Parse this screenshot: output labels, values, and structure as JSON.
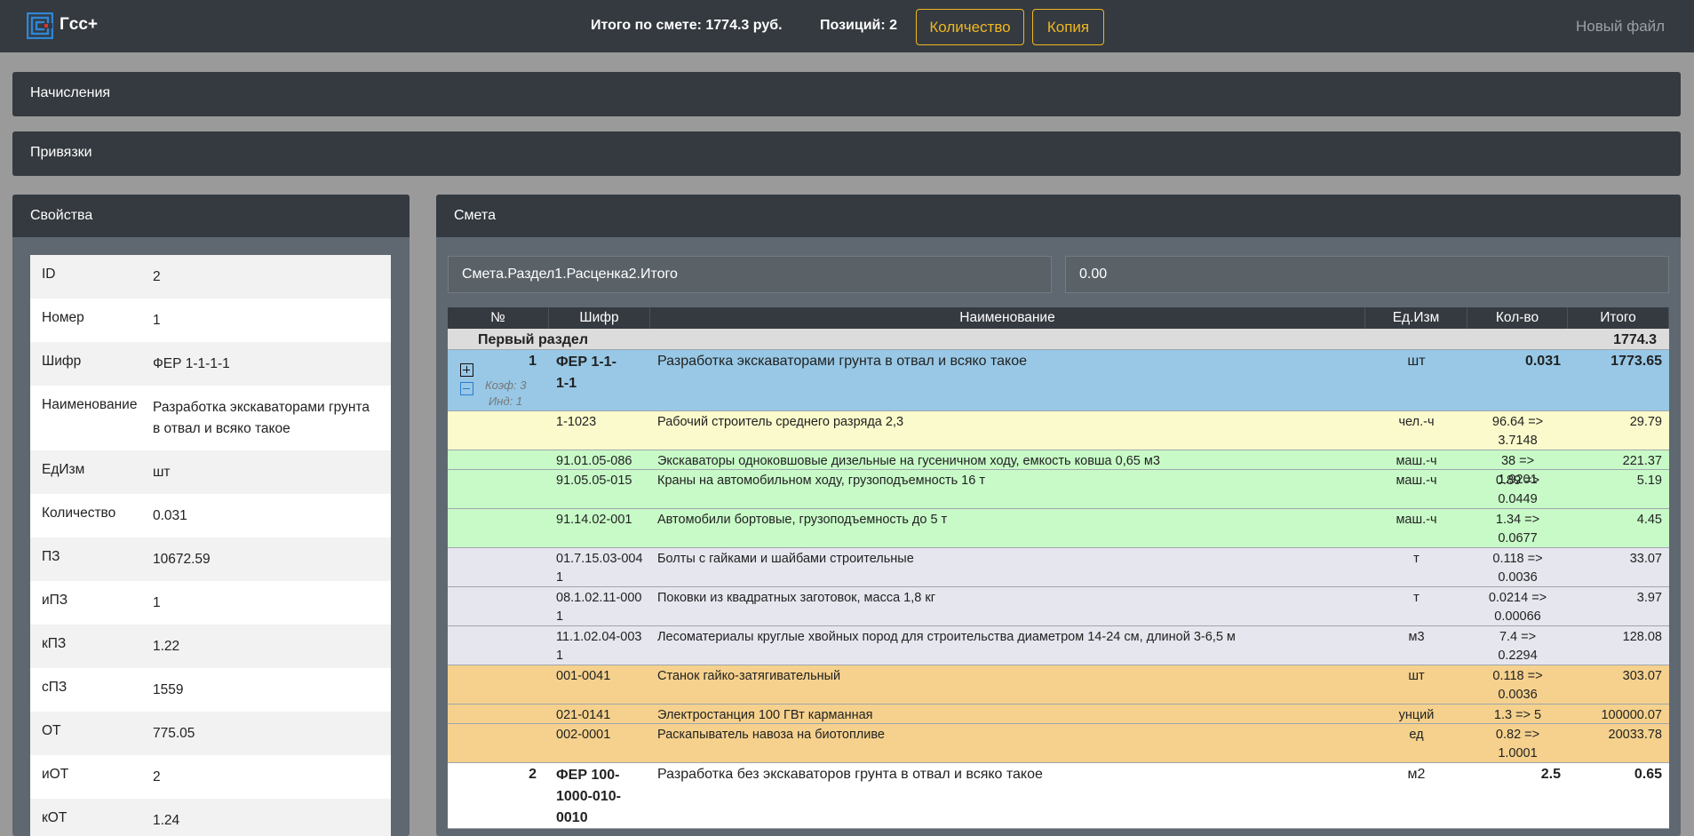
{
  "app": {
    "name": "Гсс+",
    "total_label": "Итого по смете: 1774.3 руб.",
    "positions_label": "Позиций: 2",
    "btn_quantity": "Количество",
    "btn_copy": "Копия",
    "new_file": "Новый файл",
    "accent": "#f0b722"
  },
  "cards": {
    "accruals": "Начисления",
    "links": "Привязки"
  },
  "properties": {
    "title": "Свойства",
    "rows": [
      {
        "key": "ID",
        "value": "2"
      },
      {
        "key": "Номер",
        "value": "1"
      },
      {
        "key": "Шифр",
        "value": "ФЕР 1-1-1-1"
      },
      {
        "key": "Наименование",
        "value": "Разработка экскаваторами грунта в отвал и всяко такое"
      },
      {
        "key": "ЕдИзм",
        "value": "шт"
      },
      {
        "key": "Количество",
        "value": "0.031"
      },
      {
        "key": "ПЗ",
        "value": "10672.59"
      },
      {
        "key": "иПЗ",
        "value": "1"
      },
      {
        "key": "кПЗ",
        "value": "1.22"
      },
      {
        "key": "сПЗ",
        "value": "1559"
      },
      {
        "key": "ОТ",
        "value": "775.05"
      },
      {
        "key": "иОТ",
        "value": "2"
      },
      {
        "key": "кОТ",
        "value": "1.24"
      }
    ]
  },
  "smeta": {
    "title": "Смета",
    "path_value": "Смета.Раздел1.Расценка2.Итого",
    "field_value": "0.00",
    "columns": [
      "№",
      "Шифр",
      "Наименование",
      "Ед.Изм",
      "Кол-во",
      "Итого"
    ],
    "section": {
      "name": "Первый раздел",
      "total": "1774.3"
    },
    "item1": {
      "no": "1",
      "code": "ФЕР 1-1-1-1",
      "name": "Разработка экскаваторами грунта в отвал и всяко такое",
      "unit": "шт",
      "qty": "0.031",
      "total": "1773.65",
      "coef": "Коэф: 3",
      "ind": "Инд: 1"
    },
    "resources": [
      {
        "type": "labor",
        "code": "1-1023",
        "name": "Рабочий строитель среднего разряда 2,3",
        "unit": "чел.-ч",
        "qty": "96.64 => 3.7148",
        "total": "29.79"
      },
      {
        "type": "mach",
        "code": "91.01.05-086",
        "name": "Экскаваторы одноковшовые дизельные на гусеничном ходу, емкость ковша 0,65 м3",
        "unit": "маш.-ч",
        "qty": "38 => 1.9201",
        "total": "221.37"
      },
      {
        "type": "mach",
        "code": "91.05.05-015",
        "name": "Краны на автомобильном ходу, грузоподъемность 16 т",
        "unit": "маш.-ч",
        "qty": "0.89 => 0.0449",
        "total": "5.19"
      },
      {
        "type": "mach",
        "code": "91.14.02-001",
        "name": "Автомобили бортовые, грузоподъемность до 5 т",
        "unit": "маш.-ч",
        "qty": "1.34 => 0.0677",
        "total": "4.45"
      },
      {
        "type": "mat",
        "code": "01.7.15.03-0041",
        "name": "Болты с гайками и шайбами строительные",
        "unit": "т",
        "qty": "0.118 => 0.0036",
        "total": "33.07"
      },
      {
        "type": "mat",
        "code": "08.1.02.11-0001",
        "name": "Поковки из квадратных заготовок, масса 1,8 кг",
        "unit": "т",
        "qty": "0.0214 => 0.00066",
        "total": "3.97"
      },
      {
        "type": "mat",
        "code": "11.1.02.04-0031",
        "name": "Лесоматериалы круглые хвойных пород для строительства диаметром 14-24 см, длиной 3-6,5 м",
        "unit": "м3",
        "qty": "7.4 => 0.2294",
        "total": "128.08"
      },
      {
        "type": "equip",
        "code": "001-0041",
        "name": "Станок гайко-затягивательный",
        "unit": "шт",
        "qty": "0.118 => 0.0036",
        "total": "303.07"
      },
      {
        "type": "equip",
        "code": "021-0141",
        "name": "Электростанция 100 ГВт карманная",
        "unit": "унций",
        "qty": "1.3 => 5",
        "total": "100000.07"
      },
      {
        "type": "equip",
        "code": "002-0001",
        "name": "Раскапыватель навоза на биотопливе",
        "unit": "ед",
        "qty": "0.82 => 1.0001",
        "total": "20033.78"
      }
    ],
    "item2": {
      "no": "2",
      "code": "ФЕР 100-1000-010-0010",
      "name": "Разработка без экскаваторов грунта в отвал и всяко такое",
      "unit": "м2",
      "qty": "2.5",
      "total": "0.65"
    }
  }
}
